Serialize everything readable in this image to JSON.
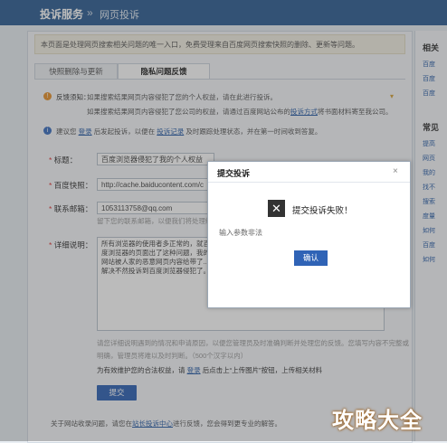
{
  "header": {
    "title": "投诉服务",
    "separator": "»",
    "subtitle": "网页投诉"
  },
  "notice": "本页面是处理网页搜索相关问题的唯一入口，免费受理来自百度网页搜索快照的删除、更新等问题。",
  "tabs": [
    {
      "label": "快照删除与更新"
    },
    {
      "label": "隐私问题反馈"
    }
  ],
  "feedback_tip": {
    "label": "反馈须知：",
    "line1": "如果搜索结果网页内容侵犯了您的个人权益，请在此进行投诉。",
    "line2": "如果搜索结果网页内容侵犯了您公司的权益，请通过百度网站公布的",
    "line2_link": "投诉方式",
    "line2_tail": "将书面材料寄至我公司。"
  },
  "suggest": {
    "pre": "建议您",
    "link1": "登录",
    "mid": "后发起投诉，以便在",
    "link2": "投诉记录",
    "tail": "及时跟踪处理状态，并在第一时间收到答复。"
  },
  "form": {
    "title_label": "标题：",
    "title_value": "百度浏览器侵犯了我的个人权益",
    "link_label": "百度快照：",
    "link_value": "http://cache.baiducontent.com/c",
    "email_label": "联系邮箱：",
    "email_value": "1053113758@qq.com",
    "email_hint": "留下您的联系邮箱，以便我们将处理结果...",
    "detail_label": "详细说明：",
    "detail_value": "所有浏览器的使用者多正常的，就百度浏览器的页面出了这种问题，我的网站被人家的恶意网页内容给带了...解决不然投诉到百度浏览器侵犯了。",
    "desc_line1": "请您详细说明遇到的情况和申请原因，以便您管理员及时准确判断并处理您的反馈。您填写内容不完整或",
    "desc_line2": "明确，管理员将难以及时判断。（500个汉字以内）",
    "upload_pre": "为有效维护您的合法权益，请",
    "upload_link": "登录",
    "upload_tail": "后点击上“上传图片”按钮，上传相关材料",
    "submit": "提交"
  },
  "footer": {
    "pre": "关于网站收录问题，请您在",
    "link": "站长投诉中心",
    "tail": "进行反馈，您会得到更专业的解答。"
  },
  "right": {
    "section1": "相关",
    "items1": [
      "百度",
      "百度",
      "百度"
    ],
    "section2": "常见",
    "items2": [
      "提高",
      "网页",
      "我的",
      "找不",
      "搜索",
      "度量",
      "如何",
      "百度",
      "如何"
    ]
  },
  "dialog": {
    "title": "提交投诉",
    "close": "×",
    "message": "提交投诉失败！",
    "detail": "输入参数非法",
    "confirm": "确认"
  },
  "watermark": "攻略大全"
}
